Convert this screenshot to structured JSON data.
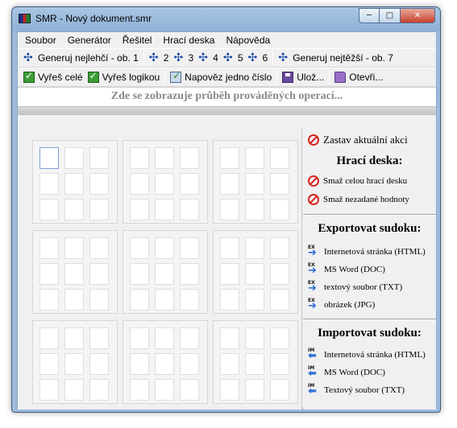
{
  "window": {
    "title": "SMR - Nový dokument.smr",
    "minimize": "─",
    "maximize": "□",
    "close": "✕"
  },
  "menu": [
    "Soubor",
    "Generátor",
    "Řešitel",
    "Hrací deska",
    "Nápověda"
  ],
  "generator_toolbar": {
    "easiest": "Generuj nejlehčí - ob. 1",
    "levels": [
      "2",
      "3",
      "4",
      "5",
      "6"
    ],
    "hardest": "Generuj nejtěžší - ob. 7",
    "icon": "generate-icon"
  },
  "action_toolbar": {
    "solve_all": "Vyřeš celé",
    "solve_logic": "Vyřeš logikou",
    "hint": "Napověz jedno číslo",
    "save": "Ulož...",
    "open": "Otevři..."
  },
  "status": "Zde se zobrazuje průběh prováděných operací...",
  "board": {
    "active_cell": 0
  },
  "side_panel": {
    "stop": "Zastav aktuální akci",
    "board_heading": "Hrací deska:",
    "clear_board": "Smaž celou hrací desku",
    "clear_unset": "Smaž nezadané hodnoty",
    "export_heading": "Exportovat sudoku:",
    "export_items": [
      "Internetová stránka (HTML)",
      "MS Word (DOC)",
      "textový soubor (TXT)",
      "obrázek (JPG)"
    ],
    "import_heading": "Importovat sudoku:",
    "import_items": [
      "Internetová stránka (HTML)",
      "MS Word (DOC)",
      "Textový soubor (TXT)"
    ],
    "export_tag": "EX",
    "import_tag": "IM"
  },
  "colors": {
    "accent_blue": "#2f6fd6",
    "stop_red": "#d4241d",
    "status_gray": "#8a8a8a"
  }
}
